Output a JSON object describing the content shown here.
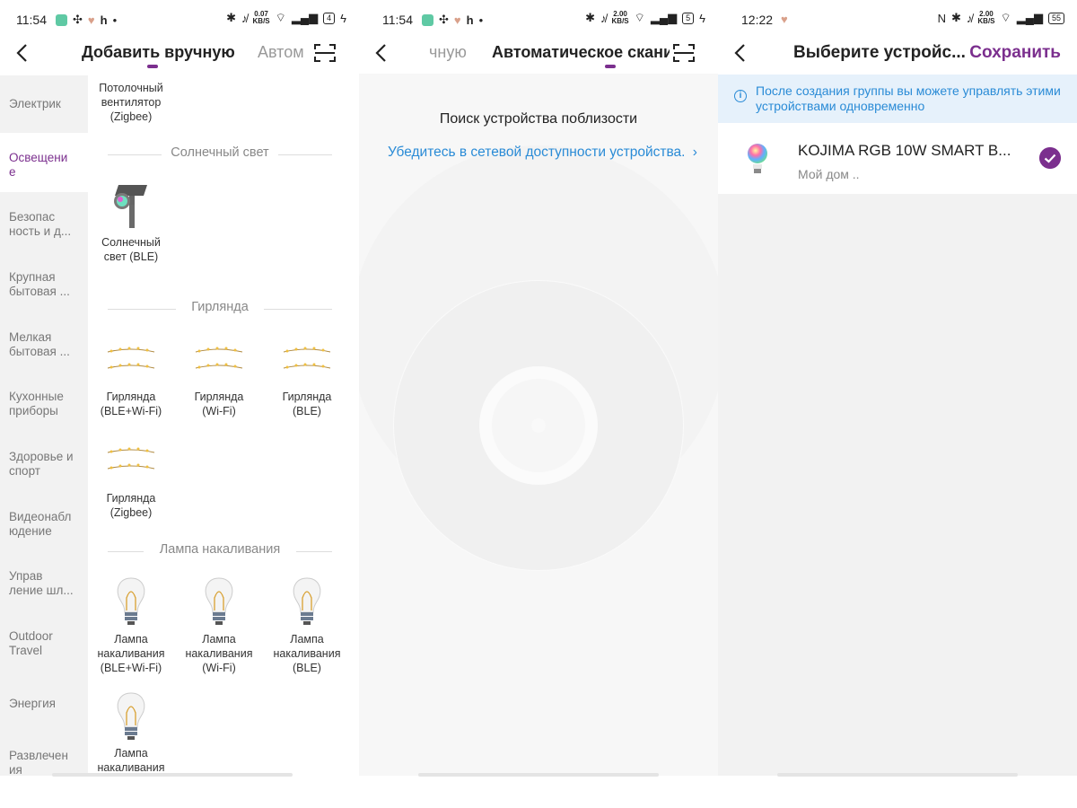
{
  "colors": {
    "accent": "#7b2f8e",
    "link": "#2a8bd6",
    "info_bg": "#e6f1fb",
    "sidebar_bg": "#f2f2f2"
  },
  "panel1": {
    "status": {
      "time": "11:54",
      "net_rate_top": "0.07",
      "net_rate_bottom": "KB/S",
      "battery": "4"
    },
    "tabs": {
      "active": "Добавить вручную",
      "inactive": "Автом"
    },
    "icons": {
      "back": "chevron-left-icon",
      "scan": "scan-frame-icon"
    },
    "sidebar": [
      {
        "label": "Электрик"
      },
      {
        "label": "Освещени е"
      },
      {
        "label": "Безопас ность и д..."
      },
      {
        "label": "Крупная бытовая ..."
      },
      {
        "label": "Мелкая бытовая ..."
      },
      {
        "label": "Кухонные приборы"
      },
      {
        "label": "Здоровье и спорт"
      },
      {
        "label": "Видеонабл юдение"
      },
      {
        "label": "Управ ление шл..."
      },
      {
        "label": "Outdoor Travel"
      },
      {
        "label": "Энергия"
      },
      {
        "label": "Развлечен ия"
      }
    ],
    "top_device": "Потолочный вентилятор (Zigbee)",
    "sections": {
      "solar": "Солнечный свет",
      "garland": "Гирлянда",
      "incandescent": "Лампа накаливания"
    },
    "solar_device": "Солнечный свет (BLE)",
    "garland_devices": [
      "Гирлянда (BLE+Wi-Fi)",
      "Гирлянда (Wi-Fi)",
      "Гирлянда (BLE)",
      "Гирлянда (Zigbee)"
    ],
    "lamp_devices": [
      "Лампа накаливания (BLE+Wi-Fi)",
      "Лампа накаливания (Wi-Fi)",
      "Лампа накаливания (BLE)",
      "Лампа накаливания"
    ]
  },
  "panel2": {
    "status": {
      "time": "11:54",
      "net_rate_top": "2.00",
      "net_rate_bottom": "KB/S",
      "battery": "5"
    },
    "tabs": {
      "inactive": "чную",
      "active": "Автоматическое скани"
    },
    "searching": "Поиск устройства поблизости",
    "network_link": "Убедитесь в сетевой доступности устройства.",
    "link_arrow": "›"
  },
  "panel3": {
    "status": {
      "time": "12:22",
      "net_rate_top": "2.00",
      "net_rate_bottom": "KB/S",
      "battery": "55"
    },
    "title": "Выберите устройс...",
    "save": "Сохранить",
    "info_icon": "i",
    "info": "После создания группы вы можете управлять этими устройствами одновременно",
    "device": {
      "name": "KOJIMA RGB 10W SMART B...",
      "home": "Мой дом ..",
      "selected": true
    }
  }
}
